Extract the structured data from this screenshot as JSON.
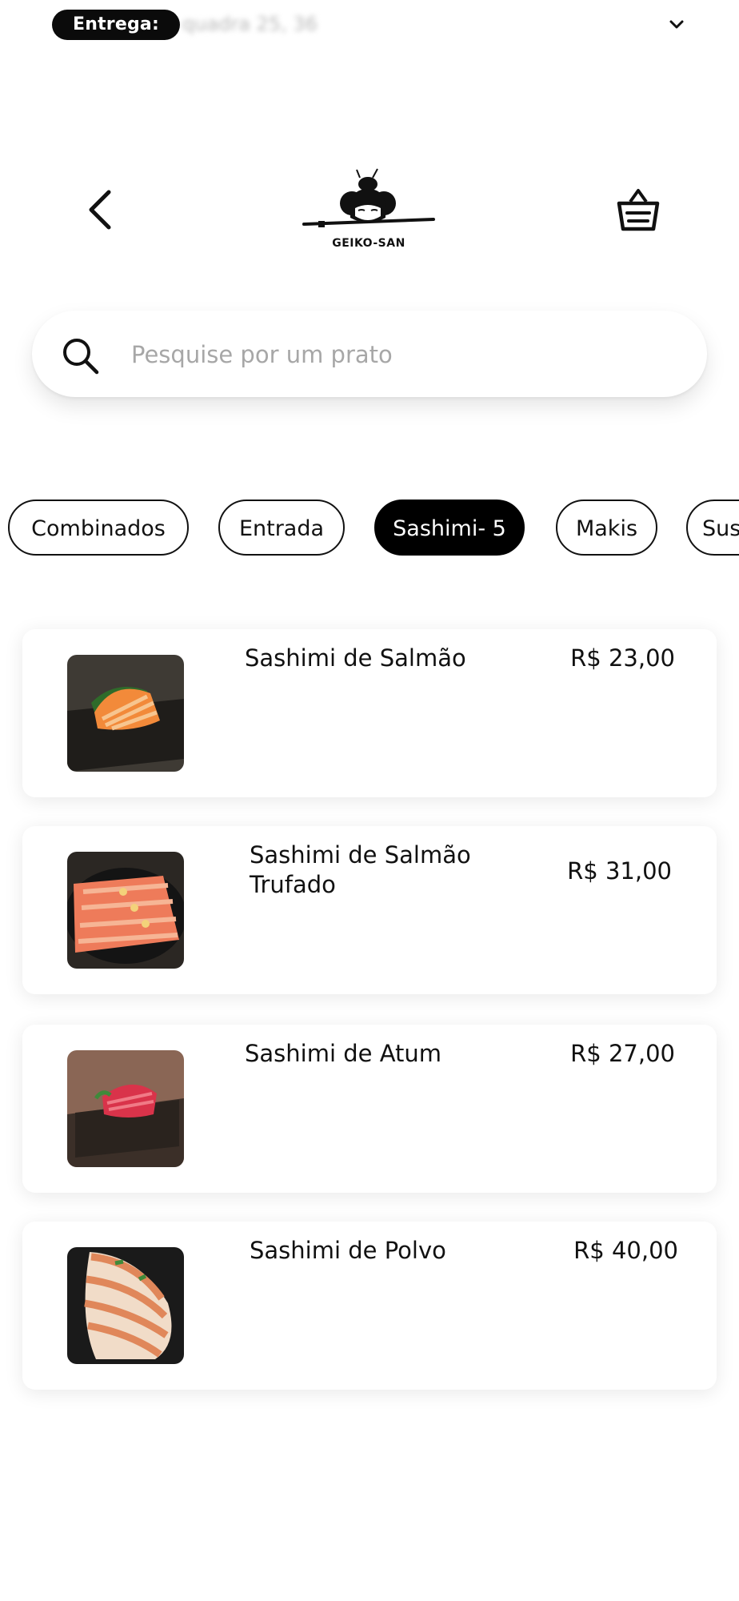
{
  "delivery": {
    "label": "Entrega:",
    "address": "quadra 25, 36"
  },
  "header": {
    "brand": "GEIKO-SAN"
  },
  "search": {
    "placeholder": "Pesquise por um prato"
  },
  "categories": [
    {
      "label": "Combinados",
      "active": false
    },
    {
      "label": "Entrada",
      "active": false
    },
    {
      "label": "Sashimi- 5",
      "active": true
    },
    {
      "label": "Makis",
      "active": false
    },
    {
      "label": "Sus",
      "active": false
    }
  ],
  "products": [
    {
      "name": "Sashimi de Salmão",
      "price": "R$ 23,00"
    },
    {
      "name": "Sashimi de Salmão Trufado",
      "price": "R$ 31,00"
    },
    {
      "name": "Sashimi de Atum",
      "price": "R$ 27,00"
    },
    {
      "name": "Sashimi de Polvo",
      "price": "R$ 40,00"
    }
  ],
  "icons": {
    "back": "chevron-left-icon",
    "cart": "basket-icon",
    "search": "search-icon",
    "dropdown": "chevron-down-icon"
  },
  "colors": {
    "accent": "#000000",
    "background": "#ffffff",
    "placeholder": "#a7a7a7"
  }
}
